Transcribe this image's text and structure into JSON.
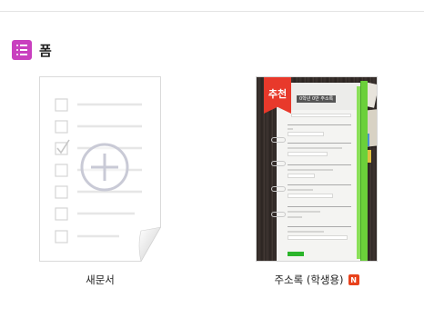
{
  "section": {
    "title": "폼",
    "icon": "list-icon",
    "icon_color": "#c93fbf"
  },
  "cards": {
    "blank": {
      "label": "새문서",
      "icons": [
        "checkbox-icon",
        "checked-checkbox-icon",
        "add-circle-icon"
      ]
    },
    "template": {
      "label": "주소록 (학생용)",
      "ribbon_text": "추천",
      "thumb_title": "0학년 0반 주소록",
      "badge": "N",
      "badge_color": "#e8421c",
      "accent_color": "#6bd03a"
    }
  }
}
